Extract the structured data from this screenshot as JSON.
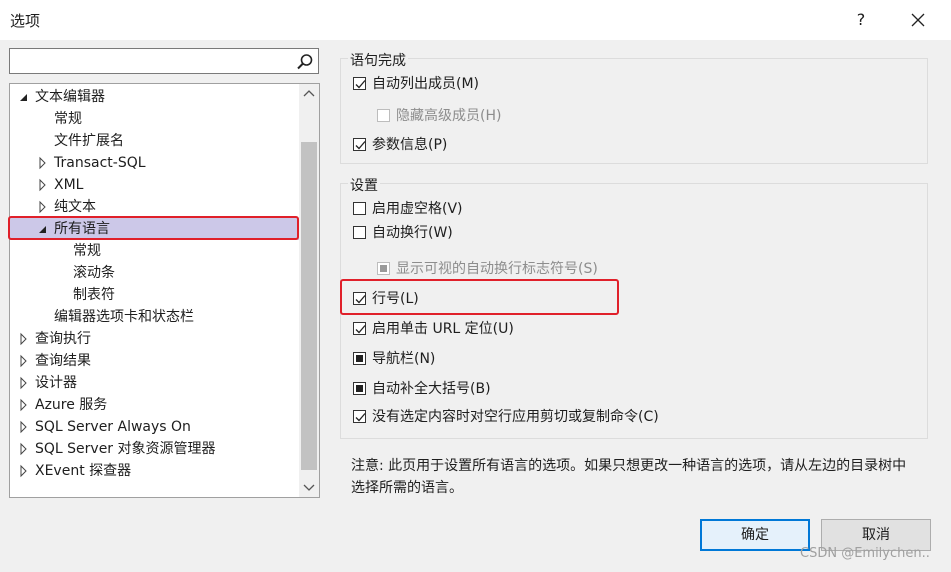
{
  "window": {
    "title": "选项",
    "help": "?"
  },
  "search": {
    "placeholder": "",
    "value": ""
  },
  "tree": [
    {
      "label": "文本编辑器",
      "arrow": "down"
    },
    {
      "label": "常规",
      "arrow": ""
    },
    {
      "label": "文件扩展名",
      "arrow": ""
    },
    {
      "label": "Transact-SQL",
      "arrow": "right"
    },
    {
      "label": "XML",
      "arrow": "right"
    },
    {
      "label": "纯文本",
      "arrow": "right"
    },
    {
      "label": "所有语言",
      "arrow": "down-selected"
    },
    {
      "label": "常规",
      "arrow": ""
    },
    {
      "label": "滚动条",
      "arrow": ""
    },
    {
      "label": "制表符",
      "arrow": ""
    },
    {
      "label": "编辑器选项卡和状态栏",
      "arrow": ""
    },
    {
      "label": "查询执行",
      "arrow": "right"
    },
    {
      "label": "查询结果",
      "arrow": "right"
    },
    {
      "label": "设计器",
      "arrow": "right"
    },
    {
      "label": "Azure 服务",
      "arrow": "right"
    },
    {
      "label": "SQL Server Always On",
      "arrow": "right"
    },
    {
      "label": "SQL Server 对象资源管理器",
      "arrow": "right"
    },
    {
      "label": "XEvent 探查器",
      "arrow": "right"
    }
  ],
  "statement_completion": {
    "title": "语句完成",
    "options": [
      {
        "label": "自动列出成员(M)",
        "state": "checked",
        "enabled": true
      },
      {
        "label": "隐藏高级成员(H)",
        "state": "unchecked",
        "enabled": false
      },
      {
        "label": "参数信息(P)",
        "state": "checked",
        "enabled": true
      }
    ]
  },
  "settings": {
    "title": "设置",
    "options": [
      {
        "label": "启用虚空格(V)",
        "state": "unchecked",
        "enabled": true
      },
      {
        "label": "自动换行(W)",
        "state": "unchecked",
        "enabled": true
      },
      {
        "label": "显示可视的自动换行标志符号(S)",
        "state": "indeterminate",
        "enabled": false
      },
      {
        "label": "行号(L)",
        "state": "checked",
        "enabled": true
      },
      {
        "label": "启用单击 URL 定位(U)",
        "state": "checked",
        "enabled": true
      },
      {
        "label": "导航栏(N)",
        "state": "indeterminate",
        "enabled": true
      },
      {
        "label": "自动补全大括号(B)",
        "state": "indeterminate",
        "enabled": true
      },
      {
        "label": "没有选定内容时对空行应用剪切或复制命令(C)",
        "state": "checked",
        "enabled": true
      }
    ]
  },
  "note": "注意: 此页用于设置所有语言的选项。如果只想更改一种语言的选项，请从左边的目录树中选择所需的语言。",
  "buttons": {
    "ok": "确定",
    "cancel": "取消"
  },
  "watermark": "CSDN @Emilychen..",
  "colors": {
    "highlight": "#e0202a",
    "selection": "#ccc8e8",
    "accent": "#0078d7"
  }
}
